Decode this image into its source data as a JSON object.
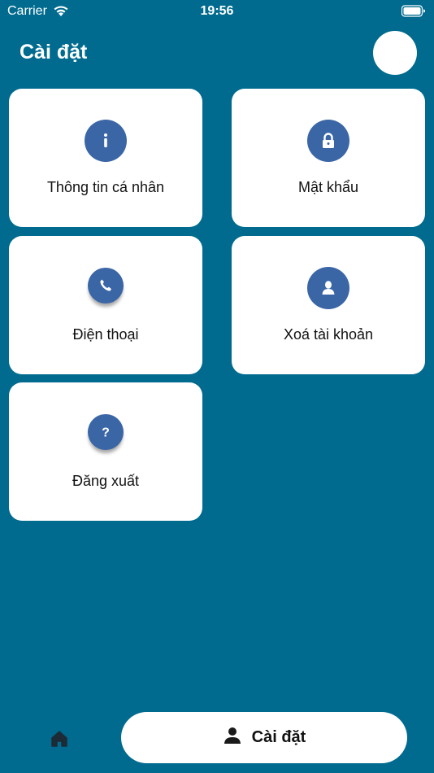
{
  "status_bar": {
    "carrier": "Carrier",
    "time": "19:56"
  },
  "header": {
    "title": "Cài đặt"
  },
  "settings_items": [
    {
      "label": "Thông tin cá nhân",
      "icon": "info-icon"
    },
    {
      "label": "Mật khẩu",
      "icon": "lock-icon"
    },
    {
      "label": "Điện thoại",
      "icon": "phone-icon"
    },
    {
      "label": "Xoá tài khoản",
      "icon": "user-icon"
    },
    {
      "label": "Đăng xuất",
      "icon": "question-icon"
    }
  ],
  "bottom_nav": {
    "active_label": "Cài đặt"
  },
  "colors": {
    "background": "#006b8f",
    "icon_circle": "#3a66a6",
    "card": "#ffffff"
  }
}
